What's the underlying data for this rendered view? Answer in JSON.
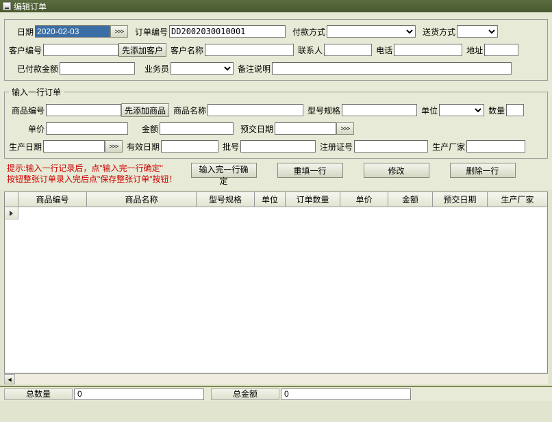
{
  "window": {
    "title": "编辑订单"
  },
  "header": {
    "date_label": "日期",
    "date_value": "2020-02-03",
    "arrow_label": ">>>",
    "order_no_label": "订单编号",
    "order_no_value": "DD2002030010001",
    "pay_method_label": "付款方式",
    "delivery_method_label": "送货方式"
  },
  "customer": {
    "cust_no_label": "客户编号",
    "add_cust_btn": "先添加客户",
    "cust_name_label": "客户名称",
    "contact_label": "联系人",
    "phone_label": "电话",
    "address_label": "地址",
    "paid_amount_label": "已付款金额",
    "salesman_label": "业务员",
    "remark_label": "备注说明"
  },
  "line": {
    "legend": "输入一行订单",
    "product_no_label": "商品编号",
    "add_product_btn": "先添加商品",
    "product_name_label": "商品名称",
    "spec_label": "型号规格",
    "unit_label": "单位",
    "qty_label": "数量",
    "price_label": "单价",
    "amount_label": "金额",
    "due_date_label": "预交日期",
    "arrow_label": ">>>",
    "prod_date_label": "生产日期",
    "valid_date_label": "有效日期",
    "batch_label": "批号",
    "reg_no_label": "注册证号",
    "manufacturer_label": "生产厂家"
  },
  "hints": {
    "line1": "提示:输入一行记录后，点\"输入完一行确定\"",
    "line2": "按钮整张订单录入完后点\"保存整张订单\"按钮！"
  },
  "actions": {
    "confirm_line": "输入完一行确定",
    "refill_line": "重填一行",
    "modify": "修改",
    "delete_line": "删除一行"
  },
  "grid": {
    "columns": [
      "商品编号",
      "商品名称",
      "型号规格",
      "单位",
      "订单数量",
      "单价",
      "金额",
      "预交日期",
      "生产厂家"
    ]
  },
  "footer": {
    "total_qty_label": "总数量",
    "total_qty_value": "0",
    "total_amount_label": "总金额",
    "total_amount_value": "0"
  }
}
